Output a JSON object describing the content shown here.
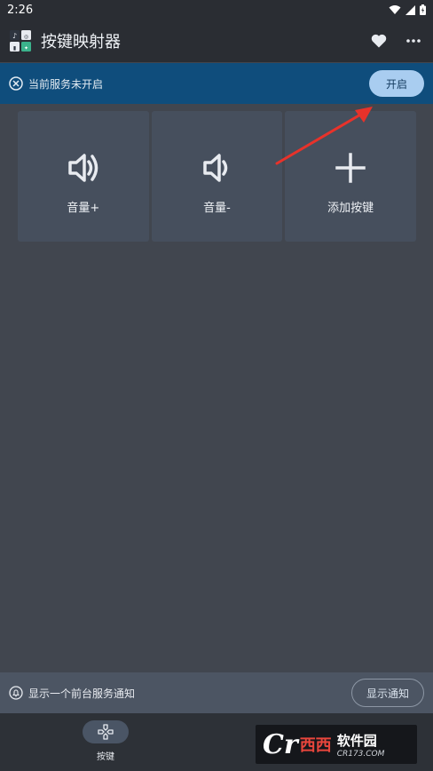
{
  "status_bar": {
    "time": "2:26"
  },
  "app_bar": {
    "title": "按键映射器",
    "icons": [
      "app-logo",
      "heart-icon",
      "more-icon"
    ]
  },
  "service_banner": {
    "text": "当前服务未开启",
    "button_label": "开启",
    "icon": "close-circle-icon"
  },
  "keys": [
    {
      "label": "音量+",
      "icon": "volume-up-icon"
    },
    {
      "label": "音量-",
      "icon": "volume-down-icon"
    },
    {
      "label": "添加按键",
      "icon": "plus-icon"
    }
  ],
  "notification": {
    "text": "显示一个前台服务通知",
    "button_label": "显示通知",
    "icon": "bell-icon"
  },
  "bottom_nav": {
    "items": [
      {
        "label": "按键",
        "icon": "gamepad-icon",
        "selected": true
      }
    ]
  },
  "watermark": {
    "logo": "Cr",
    "brand": "西西",
    "site": "软件园",
    "url": "CR173.COM"
  },
  "colors": {
    "banner": "#0f4d7c",
    "button": "#a9cdf0",
    "card": "#464f5d",
    "background": "#41464f",
    "arrow": "#e8322a"
  }
}
